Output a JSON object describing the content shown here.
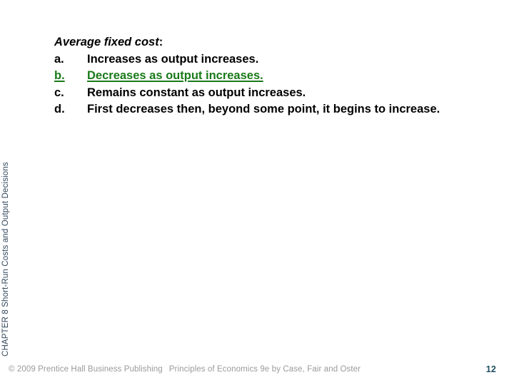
{
  "slide": {
    "background_color": "#ffffff",
    "page_number": "12"
  },
  "chapter_rail": {
    "label": "CHAPTER 8  Short-Run Costs and Output Decisions",
    "color": "#33475c"
  },
  "question": {
    "stem_italic": "Average fixed cost",
    "stem_colon": ":",
    "options": [
      {
        "letter": "a.",
        "text": "Increases as output increases.",
        "is_answer": false
      },
      {
        "letter": "b.",
        "text": "Decreases as output increases.",
        "is_answer": true
      },
      {
        "letter": "c.",
        "text": "Remains constant as output increases.",
        "is_answer": false
      },
      {
        "letter": "d.",
        "text": "First decreases then, beyond some point, it begins to increase.",
        "is_answer": false
      }
    ],
    "answer_color": "#1a7a1a"
  },
  "footer": {
    "copyright": "© 2009 Prentice Hall Business Publishing",
    "title": "Principles of Economics 9e by Case, Fair and Oster",
    "color": "#9a9a9a"
  }
}
